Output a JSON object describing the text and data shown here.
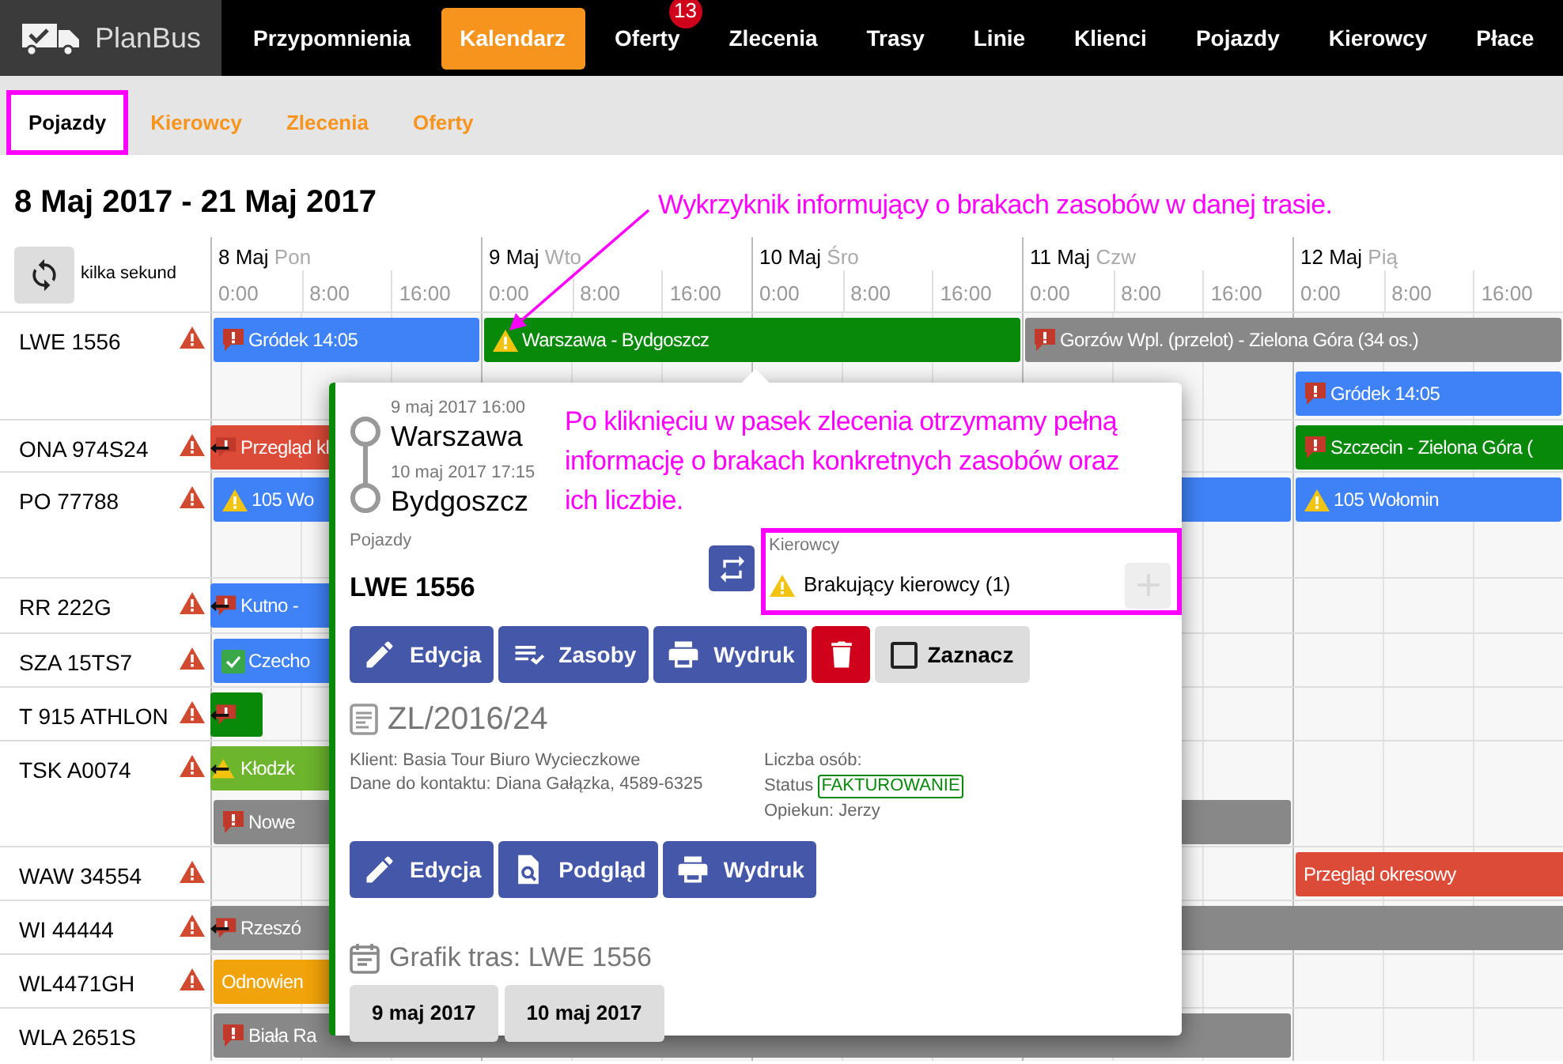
{
  "nav": {
    "logo": "PlanBus",
    "items": [
      {
        "label": "Przypomnienia",
        "selected": false
      },
      {
        "label": "Kalendarz",
        "selected": true
      },
      {
        "label": "Oferty",
        "selected": false,
        "badge": "13"
      },
      {
        "label": "Zlecenia",
        "selected": false
      },
      {
        "label": "Trasy",
        "selected": false
      },
      {
        "label": "Linie",
        "selected": false
      },
      {
        "label": "Klienci",
        "selected": false
      },
      {
        "label": "Pojazdy",
        "selected": false
      },
      {
        "label": "Kierowcy",
        "selected": false
      },
      {
        "label": "Płace",
        "selected": false
      }
    ]
  },
  "subnav": [
    {
      "label": "Pojazdy",
      "selected": true,
      "highlighted": true
    },
    {
      "label": "Kierowcy",
      "selected": false,
      "highlighted": false
    },
    {
      "label": "Zlecenia",
      "selected": false,
      "highlighted": false
    },
    {
      "label": "Oferty",
      "selected": false,
      "highlighted": false
    }
  ],
  "title": "8 Maj 2017 - 21 Maj 2017",
  "annotations": [
    "Wykrzyknik informujący o brakach zasobów w danej trasie.",
    "Po kliknięciu w pasek zlecenia otrzymamy pełną informację o brakach konkretnych zasobów oraz ich liczbie."
  ],
  "calendar": {
    "refresh_label": "kilka sekund",
    "days": [
      {
        "date": "8 Maj",
        "weekday": "Pon",
        "hours": [
          "0:00",
          "8:00",
          "16:00"
        ]
      },
      {
        "date": "9 Maj",
        "weekday": "Wto",
        "hours": [
          "0:00",
          "8:00",
          "16:00"
        ]
      },
      {
        "date": "10 Maj",
        "weekday": "Śro",
        "hours": [
          "0:00",
          "8:00",
          "16:00"
        ]
      },
      {
        "date": "11 Maj",
        "weekday": "Czw",
        "hours": [
          "0:00",
          "8:00",
          "16:00"
        ]
      },
      {
        "date": "12 Maj",
        "weekday": "Pią",
        "hours": [
          "0:00",
          "8:00",
          "16:00"
        ]
      }
    ],
    "rows": [
      {
        "vehicle": "LWE 1556",
        "warning": true,
        "bars": [
          {
            "label": "Gródek 14:05",
            "color": "#3f82f7",
            "kind": "alert"
          },
          {
            "label": "Warszawa - Bydgoszcz",
            "color": "#08890a",
            "kind": "warning"
          },
          {
            "label": "Gorzów Wpl. (przelot) - Zielona Góra (34 os.)",
            "color": "#888888",
            "kind": "alert"
          },
          {
            "label": "Gródek 14:05",
            "color": "#3f82f7",
            "kind": "alert"
          }
        ]
      },
      {
        "vehicle": "ONA 974S24",
        "warning": true,
        "bars": [
          {
            "label": "Przegląd kl",
            "color": "#dc4a38",
            "kind": "moved-alert"
          },
          {
            "label": "Szczecin - Zielona Góra (",
            "color": "#08890a",
            "kind": "alert"
          }
        ]
      },
      {
        "vehicle": "PO 77788",
        "warning": true,
        "bars": [
          {
            "label": "105 Wo",
            "color": "#3f82f7",
            "kind": "warning"
          },
          {
            "label": "105 Wołomin",
            "color": "#3f82f7",
            "kind": "warning"
          }
        ]
      },
      {
        "vehicle": "RR 222G",
        "warning": true,
        "bars": [
          {
            "label": "Kutno -",
            "color": "#3f82f7",
            "kind": "moved-alert"
          }
        ]
      },
      {
        "vehicle": "SZA 15TS7",
        "warning": true,
        "bars": [
          {
            "label": "Czecho",
            "color": "#3f82f7",
            "kind": "check"
          }
        ]
      },
      {
        "vehicle": "T 915 ATHLON",
        "warning": true,
        "bars": [
          {
            "color": "#08890a",
            "kind": "moved-alert"
          }
        ]
      },
      {
        "vehicle": "TSK A0074",
        "warning": true,
        "bars": [
          {
            "label": "Kłodzk",
            "color": "#6cb52d",
            "kind": "moved-warning"
          },
          {
            "label": "Nowe",
            "color": "#888888",
            "kind": "alert"
          }
        ]
      },
      {
        "vehicle": "WAW 34554",
        "warning": true,
        "bars": [
          {
            "label": "Przegląd okresowy",
            "color": "#dc4a38"
          }
        ]
      },
      {
        "vehicle": "WI 44444",
        "warning": true,
        "bars": [
          {
            "label": "Rzeszó",
            "color": "#888888",
            "kind": "moved-alert"
          }
        ]
      },
      {
        "vehicle": "WL4471GH",
        "warning": true,
        "bars": [
          {
            "label": "Odnowien",
            "color": "#f0a30a"
          }
        ]
      },
      {
        "vehicle": "WLA 2651S",
        "warning": false,
        "bars": [
          {
            "label": "Biała Ra",
            "color": "#888888",
            "kind": "alert"
          }
        ]
      }
    ]
  },
  "popup": {
    "route": [
      {
        "time": "9 maj 2017 16:00",
        "place": "Warszawa"
      },
      {
        "time": "10 maj 2017 17:15",
        "place": "Bydgoszcz"
      }
    ],
    "vehicles": {
      "label": "Pojazdy",
      "value": "LWE 1556"
    },
    "drivers": {
      "label": "Kierowcy",
      "missing": "Brakujący kierowcy (1)",
      "highlighted": true
    },
    "actions": [
      {
        "kind": "edit",
        "label": "Edycja"
      },
      {
        "kind": "resources",
        "label": "Zasoby"
      },
      {
        "kind": "print",
        "label": "Wydruk"
      },
      {
        "kind": "delete"
      },
      {
        "kind": "select",
        "label": "Zaznacz",
        "checked": false
      }
    ],
    "order": {
      "number": "ZL/2016/24",
      "client": "Klient: Basia Tour Biuro Wycieczkowe",
      "contact": "Dane do kontaktu: Diana Gałązka, 4589-6325",
      "people": "Liczba osób:",
      "status_label": "Status",
      "status": "FAKTUROWANIE",
      "guardian": "Opiekun: Jerzy"
    },
    "order_actions": [
      {
        "kind": "edit",
        "label": "Edycja"
      },
      {
        "kind": "preview",
        "label": "Podgląd"
      },
      {
        "kind": "print",
        "label": "Wydruk"
      }
    ],
    "schedule": {
      "title": "Grafik tras: LWE 1556",
      "dates": [
        "9 maj 2017",
        "10 maj 2017"
      ]
    }
  }
}
